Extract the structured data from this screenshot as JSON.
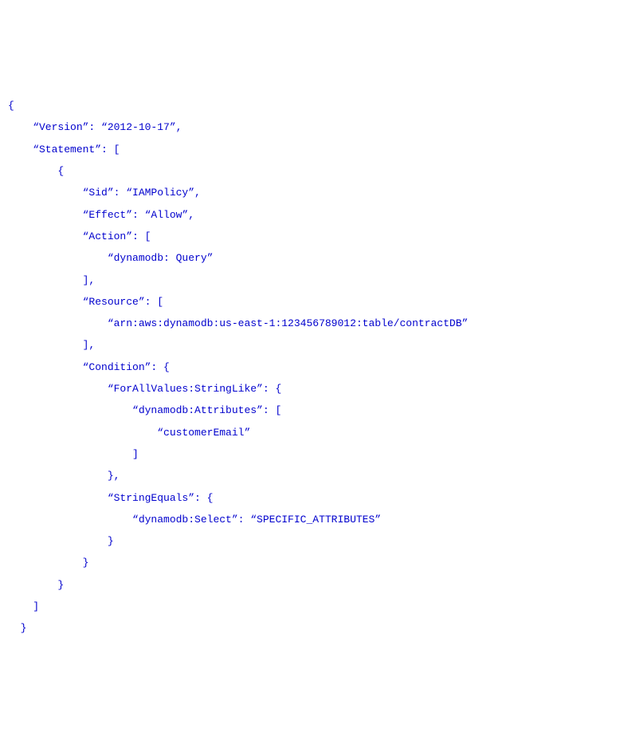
{
  "policy": {
    "lines": [
      "{",
      "    “Version”: “2012-10-17”,",
      "    “Statement”: [",
      "        {",
      "            “Sid”: “IAMPolicy”,",
      "            “Effect”: “Allow”,",
      "            “Action”: [",
      "                “dynamodb: Query”",
      "            ],",
      "            “Resource”: [",
      "                “arn:aws:dynamodb:us-east-1:123456789012:table/contractDB”",
      "            ],",
      "            “Condition”: {",
      "                “ForAllValues:StringLike”: {",
      "                    “dynamodb:Attributes”: [",
      "                        “customerEmail”",
      "                    ]",
      "                },",
      "                “StringEquals”: {",
      "                    “dynamodb:Select”: “SPECIFIC_ATTRIBUTES”",
      "                }",
      "            }",
      "        }",
      "    ]",
      "  }"
    ]
  }
}
